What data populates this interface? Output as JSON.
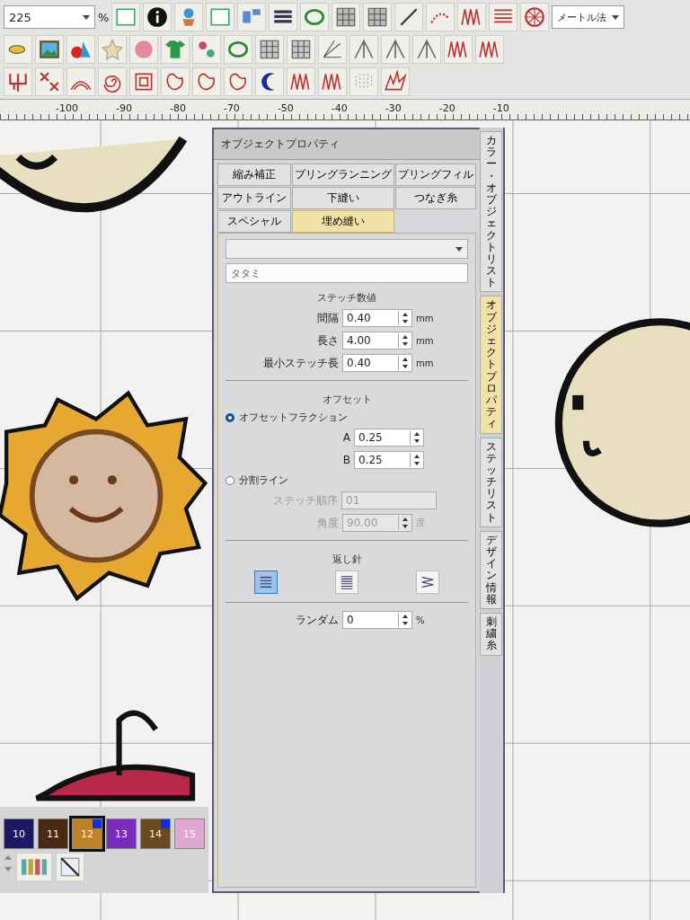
{
  "toolbar": {
    "zoom": {
      "value": "225",
      "unit": "%"
    },
    "units": {
      "value": "メートル法"
    }
  },
  "ruler": {
    "labels": [
      "-100",
      "-90",
      "-80",
      "-70",
      "-50",
      "-40",
      "-30",
      "-20",
      "-10"
    ]
  },
  "panel": {
    "title": "オブジェクトプロパティ",
    "tabs": [
      {
        "label": "縮み補正",
        "selected": false
      },
      {
        "label": "プリングランニング",
        "selected": false
      },
      {
        "label": "プリングフィル",
        "selected": false
      },
      {
        "label": "アウトライン",
        "selected": false
      },
      {
        "label": "下縫い",
        "selected": false
      },
      {
        "label": "つなぎ糸",
        "selected": false
      },
      {
        "label": "スペシャル",
        "selected": false
      },
      {
        "label": "埋め縫い",
        "selected": true
      }
    ],
    "fill_type": {
      "value": "タタミ"
    },
    "stitch_values": {
      "heading": "ステッチ数値",
      "fields": [
        {
          "label": "間隔",
          "value": "0.40",
          "unit": "mm"
        },
        {
          "label": "長さ",
          "value": "4.00",
          "unit": "mm"
        },
        {
          "label": "最小ステッチ長",
          "value": "0.40",
          "unit": "mm"
        }
      ]
    },
    "offset": {
      "heading": "オフセット",
      "options": [
        {
          "label": "オフセットフラクション",
          "selected": true,
          "fields": [
            {
              "label": "A",
              "value": "0.25",
              "kind": "spin",
              "disabled": false
            },
            {
              "label": "B",
              "value": "0.25",
              "kind": "spin",
              "disabled": false
            }
          ]
        },
        {
          "label": "分割ライン",
          "selected": false,
          "fields": [
            {
              "label": "ステッチ順序",
              "value": "01",
              "kind": "plain",
              "disabled": true
            },
            {
              "label": "角度",
              "value": "90.00",
              "unit": "度",
              "kind": "spin",
              "disabled": true
            }
          ]
        }
      ]
    },
    "backstitch": {
      "heading": "返し針",
      "options": [
        {
          "kind": "straight",
          "selected": true
        },
        {
          "kind": "dense",
          "selected": false
        },
        {
          "kind": "zigzag",
          "selected": false
        }
      ]
    },
    "random": {
      "label": "ランダム",
      "value": "0",
      "unit": "%"
    }
  },
  "side_tabs": [
    {
      "label": "カラー・オブジェクトリスト",
      "selected": false
    },
    {
      "label": "オブジェクトプロパティ",
      "selected": true
    },
    {
      "label": "ステッチリスト",
      "selected": false
    },
    {
      "label": "デザイン情報",
      "selected": false
    },
    {
      "label": "刺繍糸",
      "selected": false
    }
  ],
  "palette": {
    "colors": [
      {
        "label": "10",
        "color": "#1c1866",
        "selected": false,
        "marked": false
      },
      {
        "label": "11",
        "color": "#4a2a14",
        "selected": false,
        "marked": false
      },
      {
        "label": "12",
        "color": "#c08428",
        "selected": true,
        "marked": true
      },
      {
        "label": "13",
        "color": "#7a2cc0",
        "selected": false,
        "marked": false
      },
      {
        "label": "14",
        "color": "#6a4a1e",
        "selected": false,
        "marked": true
      },
      {
        "label": "15",
        "color": "#e0a8d0",
        "selected": false,
        "marked": false
      }
    ]
  }
}
